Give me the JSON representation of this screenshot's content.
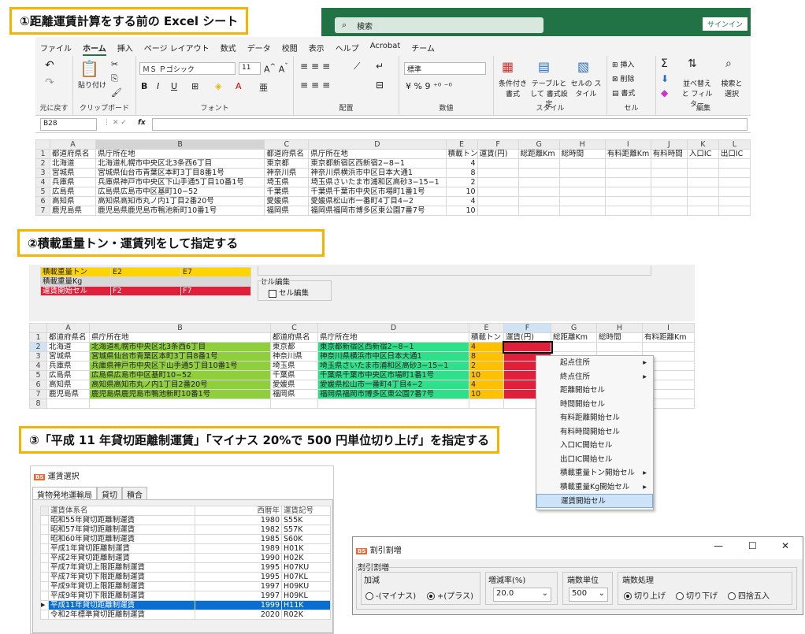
{
  "callouts": {
    "c1": "①距離運賃計算をする前の Excel シート",
    "c2": "②積載重量トン・運賃列をして指定する",
    "c3": "③「平成 11 年貸切距離制運賃」「マイナス 20%で 500 円単位切り上げ」を指定する"
  },
  "excel": {
    "search_placeholder": "検索",
    "signin": "サインイン",
    "menu": [
      "ファイル",
      "ホーム",
      "挿入",
      "ページ レイアウト",
      "数式",
      "データ",
      "校閲",
      "表示",
      "ヘルプ",
      "Acrobat",
      "チーム"
    ],
    "active_menu": "ホーム",
    "ribbon": {
      "undo": "元に戻す",
      "clipboard": "クリップボード",
      "paste": "貼り付け",
      "font_group": "フォント",
      "font_name": "ＭＳ Ｐゴシック",
      "font_size": "11",
      "align_group": "配置",
      "number_group": "数値",
      "number_format": "標準",
      "style_group": "スタイル",
      "cond_format": "条件付き 書式",
      "table_format": "テーブルとして 書式設定",
      "cell_style": "セルの スタイル",
      "cell_group": "セル",
      "insert": "挿入",
      "delete": "削除",
      "format": "書式",
      "edit_group": "編集",
      "sort_filter": "並べ替えと フィルター",
      "find_select": "検索と 選択"
    },
    "namebox": "B28",
    "fx": "fx",
    "columns": [
      "A",
      "B",
      "C",
      "D",
      "E",
      "F",
      "G",
      "H",
      "I",
      "J",
      "K",
      "L"
    ],
    "header_row": [
      "都道府県名",
      "県庁所在地",
      "都道府県名",
      "県庁所在地",
      "積載トン",
      "運賃(円)",
      "総距離Km",
      "総時間",
      "有料距離Km",
      "有料時間",
      "入口IC",
      "出口IC"
    ],
    "rows": [
      [
        "北海道",
        "北海道札幌市中央区北3条西6丁目",
        "東京都",
        "東京都新宿区西新宿2−8−1",
        "4"
      ],
      [
        "宮城県",
        "宮城県仙台市青葉区本町3丁目8番1号",
        "神奈川県",
        "神奈川県横浜市中区日本大通1",
        "8"
      ],
      [
        "兵庫県",
        "兵庫県神戸市中央区下山手通5丁目10番1号",
        "埼玉県",
        "埼玉県さいたま市浦和区高砂3−15−1",
        "2"
      ],
      [
        "広島県",
        "広島県広島市中区基町10−52",
        "千葉県",
        "千葉県千葉市中央区市場町1番1号",
        "10"
      ],
      [
        "高知県",
        "高知県高知市丸ノ内1丁目2番20号",
        "愛媛県",
        "愛媛県松山市一番町4丁目4−2",
        "4"
      ],
      [
        "鹿児島県",
        "鹿児島県鹿児島市鴨池新町10番1号",
        "福岡県",
        "福岡県福岡市博多区東公園7番7号",
        "10"
      ]
    ]
  },
  "settings": {
    "rows": [
      {
        "label": "積載重量トン",
        "v1": "E2",
        "v2": "E7"
      },
      {
        "label": "積載重量Kg",
        "v1": "",
        "v2": ""
      },
      {
        "label": "運賃開始セル",
        "v1": "F2",
        "v2": "F7"
      }
    ],
    "cell_edit_group": "セル編集",
    "cell_edit_check": "セル編集"
  },
  "sheet2": {
    "columns": [
      "A",
      "B",
      "C",
      "D",
      "E",
      "F",
      "G",
      "H",
      "I"
    ],
    "header_row": [
      "都道府県名",
      "県庁所在地",
      "都道府県名",
      "県庁所在地",
      "積載トン",
      "運賃(円)",
      "総距離Km",
      "総時間",
      "有料距離Km"
    ]
  },
  "context_menu": [
    {
      "label": "起点住所",
      "sub": true
    },
    {
      "label": "終点住所",
      "sub": true
    },
    {
      "label": "距離開始セル",
      "sub": false
    },
    {
      "label": "時間開始セル",
      "sub": false
    },
    {
      "label": "有料距離開始セル",
      "sub": false
    },
    {
      "label": "有料時間開始セル",
      "sub": false
    },
    {
      "label": "入口IC開始セル",
      "sub": false
    },
    {
      "label": "出口IC開始セル",
      "sub": false
    },
    {
      "label": "積載重量トン開始セル",
      "sub": true
    },
    {
      "label": "積載重量Kg開始セル",
      "sub": true
    },
    {
      "label": "運賃開始セル",
      "sub": false
    }
  ],
  "fare_dialog": {
    "title": "運賃選択",
    "tabs": [
      "貨物発地運輸局",
      "貸切",
      "積合"
    ],
    "headers": [
      "運賃体系名",
      "西暦年",
      "運賃記号"
    ],
    "rows": [
      [
        "昭和55年貸切距離制運賃",
        "1980",
        "S55K"
      ],
      [
        "昭和57年貸切距離制運賃",
        "1982",
        "S57K"
      ],
      [
        "昭和60年貸切距離制運賃",
        "1985",
        "S60K"
      ],
      [
        "平成1年貸切距離制運賃",
        "1989",
        "H01K"
      ],
      [
        "平成2年貸切距離制運賃",
        "1990",
        "H02K"
      ],
      [
        "平成7年貸切上限距離制運賃",
        "1995",
        "H07KU"
      ],
      [
        "平成7年貸切下限距離制運賃",
        "1995",
        "H07KL"
      ],
      [
        "平成9年貸切上限距離制運賃",
        "1997",
        "H09KU"
      ],
      [
        "平成9年貸切下限距離制運賃",
        "1997",
        "H09KL"
      ],
      [
        "平成11年貸切距離制運賃",
        "1999",
        "H11K"
      ],
      [
        "令和2年標準貸切距離制運賃",
        "2020",
        "R02K"
      ]
    ],
    "selected_index": 9
  },
  "discount_dialog": {
    "title": "割引割増",
    "group": "割引割増",
    "sign_group": "加減",
    "minus": "-(マイナス)",
    "plus": "+(プラス)",
    "rate_label": "増減率(%)",
    "rate_value": "20.0",
    "unit_label": "端数単位",
    "unit_value": "500",
    "round_label": "端数処理",
    "round_up": "切り上げ",
    "round_down": "切り下げ",
    "round_half": "四捨五入",
    "minimize": "—",
    "maximize": "☐",
    "close": "✕"
  },
  "colors": {
    "excel_green": "#217346",
    "callout_border": "#f5b301",
    "green_cell": "#8fcf3c",
    "mint_cell": "#2ee08a",
    "orange_cell": "#ffc000",
    "red_cell": "#e0203a",
    "selection_blue": "#0a6ed1"
  }
}
